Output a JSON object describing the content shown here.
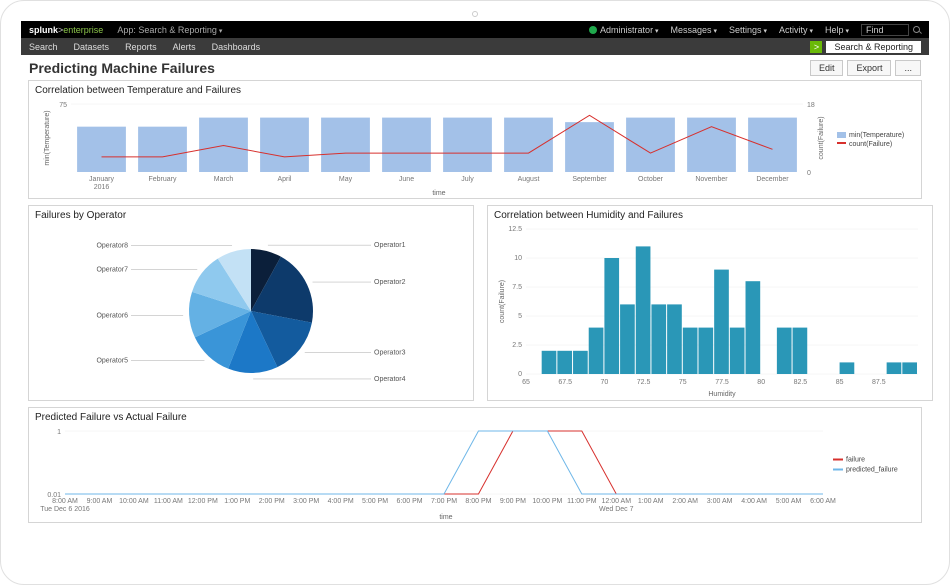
{
  "topbar": {
    "brand_a": "splunk",
    "brand_b": "enterprise",
    "app_sel": "App: Search & Reporting",
    "admin": "Administrator",
    "messages": "Messages",
    "settings": "Settings",
    "activity": "Activity",
    "help": "Help",
    "find": "Find"
  },
  "secbar": {
    "search": "Search",
    "datasets": "Datasets",
    "reports": "Reports",
    "alerts": "Alerts",
    "dashboards": "Dashboards",
    "sr": "Search & Reporting"
  },
  "page": {
    "title": "Predicting Machine Failures",
    "edit": "Edit",
    "export": "Export",
    "more": "..."
  },
  "panels": {
    "p1_title": "Correlation between Temperature and Failures",
    "p2_title": "Failures by Operator",
    "p3_title": "Correlation between Humidity and Failures",
    "p4_title": "Predicted Failure vs Actual Failure"
  },
  "chart_data": [
    {
      "id": "temp_fail",
      "type": "bar+line",
      "xlabel": "_time",
      "y1label": "min(Temperature)",
      "y2label": "count(Failure)",
      "y1lim": [
        60,
        75
      ],
      "y2lim": [
        0,
        18
      ],
      "categories": [
        "January 2016",
        "February",
        "March",
        "April",
        "May",
        "June",
        "July",
        "August",
        "September",
        "October",
        "November",
        "December"
      ],
      "series": [
        {
          "name": "min(Temperature)",
          "type": "bar",
          "color": "#a3c1e8",
          "values": [
            70,
            70,
            72,
            72,
            72,
            72,
            72,
            72,
            71,
            72,
            72,
            72
          ]
        },
        {
          "name": "count(Failure)",
          "type": "line",
          "color": "#d7302d",
          "values": [
            4,
            4,
            7,
            4,
            5,
            5,
            5,
            5,
            15,
            5,
            12,
            6
          ]
        }
      ]
    },
    {
      "id": "by_operator",
      "type": "pie",
      "series": [
        {
          "name": "Operator1",
          "value": 8,
          "color": "#0b1f3a"
        },
        {
          "name": "Operator2",
          "value": 20,
          "color": "#0d3a6b"
        },
        {
          "name": "Operator3",
          "value": 15,
          "color": "#135b9e"
        },
        {
          "name": "Operator4",
          "value": 13,
          "color": "#1c78c7"
        },
        {
          "name": "Operator5",
          "value": 12,
          "color": "#3a95d8"
        },
        {
          "name": "Operator6",
          "value": 12,
          "color": "#64b1e4"
        },
        {
          "name": "Operator7",
          "value": 11,
          "color": "#8fc9ee"
        },
        {
          "name": "Operator8",
          "value": 9,
          "color": "#c3e1f5"
        }
      ]
    },
    {
      "id": "humidity_fail",
      "type": "bar",
      "xlabel": "Humidity",
      "ylabel": "count(Failure)",
      "ylim": [
        0,
        12.5
      ],
      "xticks": [
        65,
        67.5,
        70,
        72.5,
        75,
        77.5,
        80,
        82.5,
        85,
        87.5
      ],
      "categories": [
        65,
        66,
        67,
        68,
        69,
        70,
        71,
        72,
        73,
        74,
        75,
        76,
        77,
        78,
        79,
        80,
        81,
        82,
        83,
        84,
        85,
        86,
        87,
        88,
        89
      ],
      "color": "#2a97b7",
      "values": [
        0,
        2,
        2,
        2,
        4,
        10,
        6,
        11,
        6,
        6,
        4,
        4,
        9,
        4,
        8,
        0,
        4,
        4,
        0,
        0,
        1,
        0,
        0,
        1,
        1
      ]
    },
    {
      "id": "predicted_actual",
      "type": "line",
      "xlabel": "_time",
      "ylim": [
        0.01,
        1
      ],
      "xticks": [
        "8:00 AM Tue Dec 6 2016",
        "9:00 AM",
        "10:00 AM",
        "11:00 AM",
        "12:00 PM",
        "1:00 PM",
        "2:00 PM",
        "3:00 PM",
        "4:00 PM",
        "5:00 PM",
        "6:00 PM",
        "7:00 PM",
        "8:00 PM",
        "9:00 PM",
        "10:00 PM",
        "11:00 PM",
        "12:00 AM Wed Dec 7",
        "1:00 AM",
        "2:00 AM",
        "3:00 AM",
        "4:00 AM",
        "5:00 AM",
        "6:00 AM"
      ],
      "series": [
        {
          "name": "failure",
          "color": "#d7302d",
          "points": [
            [
              12,
              0.01
            ],
            [
              13,
              1
            ],
            [
              15,
              1
            ],
            [
              16,
              0.01
            ]
          ]
        },
        {
          "name": "predicted_failure",
          "color": "#6fb7e8",
          "points": [
            [
              11,
              0.01
            ],
            [
              12,
              1
            ],
            [
              14,
              1
            ],
            [
              15,
              0.01
            ]
          ]
        }
      ]
    }
  ]
}
